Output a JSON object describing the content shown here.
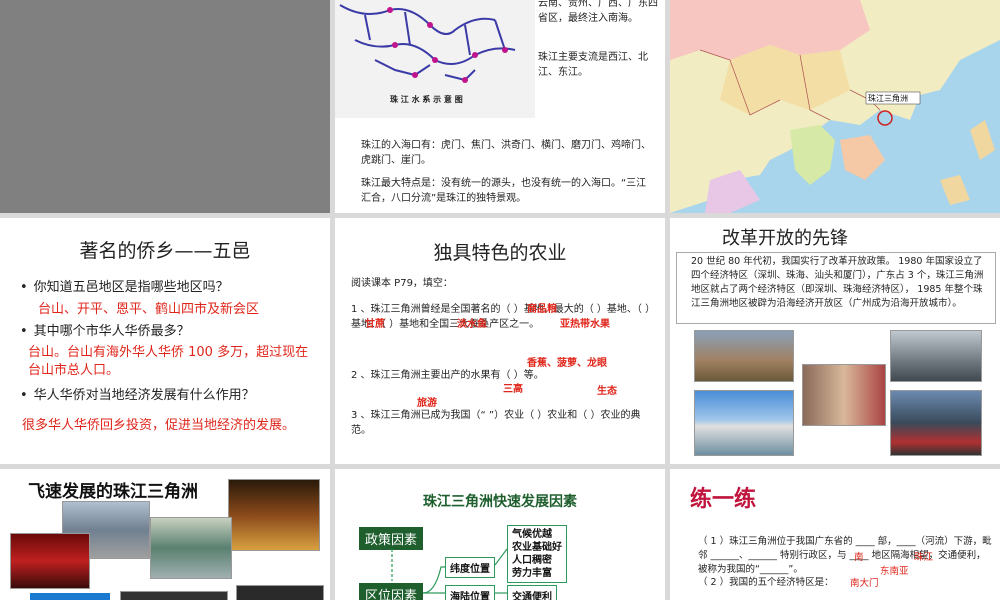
{
  "slide2": {
    "diagram_caption": "珠 江 水 系 示 意 图",
    "para1": "云南、贵州、广西、广东四省区，最终注入南海。",
    "para2": "珠江主要支流是西江、北江、东江。",
    "para3": "珠江的入海口有：虎门、焦门、洪奇门、横门、磨刀门、鸡啼门、虎跳门、崖门。",
    "para4": "珠江最大特点是：没有统一的源头，也没有统一的入海口。“三江汇合，八口分流”是珠江的独特景观。"
  },
  "slide3": {
    "map_label": "珠江三角洲"
  },
  "slide4": {
    "title": "著名的侨乡——五邑",
    "q1": "你知道五邑地区是指哪些地区吗？",
    "a1": "台山、开平、恩平、鹤山四市及新会区",
    "q2": "其中哪个市华人华侨最多？",
    "a2": "台山。台山有海外华人华侨 100 多万，超过现在台山市总人口。",
    "q3": "华人华侨对当地经济发展有什么作用？",
    "a3": "很多华人华侨回乡投资，促进当地经济的发展。"
  },
  "slide5": {
    "title": "独具特色的农业",
    "intro": "阅读课本 P79，填空：",
    "q1": "1 、珠江三角洲曾经是全国著名的（ ）基地、最大的（ ）基地、（ ）基地、（ ）基地和全国三大蚕桑产区之一。",
    "q2": "2 、珠江三角洲主要出产的水果有（ ）等。",
    "q3": "3 、珠江三角洲已成为我国（“ ”）农业（ ）农业和（ ）农业的典范。",
    "ans_1": "商品粮",
    "ans_2": "甘蔗",
    "ans_3": "淡水鱼",
    "ans_4": "亚热带水果",
    "ans_5": "香蕉、菠萝、龙眼",
    "ans_6": "三高",
    "ans_7": "生态",
    "ans_8": "旅游"
  },
  "slide6": {
    "title": "改革开放的先锋",
    "text": "20 世纪 80 年代初，我国实行了改革开放政策。 1980 年国家设立了四个经济特区（深圳、珠海、汕头和厦门），广东占 3 个，珠江三角洲地区就占了两个经济特区（即深圳、珠海经济特区）， 1985 年整个珠江三角洲地区被辟为沿海经济开放区（广州成为沿海开放城市）。"
  },
  "slide7": {
    "title": "飞速发展的珠江三角洲"
  },
  "slide8": {
    "title": "珠江三角洲快速发展因素",
    "policy": "政策因素",
    "location": "区位因素",
    "lat": "纬度位置",
    "lat_detail": "气候优越\n农业基础好\n人口稠密\n劳力丰富",
    "sea": "海陆位置",
    "sea_detail": "交通便利"
  },
  "slide9": {
    "title": "练一练",
    "q1": "（ 1 ）珠江三角洲位于我国广东省的 ____ 部，____（河流）下游，毗邻 ______、______ 特别行政区，与 ____ 地区隔海相望，交通便利，被称为我国的“______”。",
    "q2": "（ 2 ）我国的五个经济特区是：",
    "ans_south": "南",
    "ans_zhujiang": "珠江",
    "ans_south_gate": "南大门",
    "ans_southeast": "东南亚"
  },
  "colors": {
    "answer_red": "#e0261b",
    "dark_green": "#1f5f2e",
    "title_red": "#c0143c"
  }
}
